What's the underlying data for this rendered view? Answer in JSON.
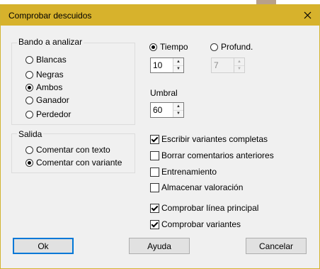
{
  "window": {
    "title": "Comprobar descuidos"
  },
  "side_group": {
    "label": "Bando a analizar",
    "options": [
      "Blancas",
      "Negras",
      "Ambos",
      "Ganador",
      "Perdedor"
    ],
    "selected": "Ambos"
  },
  "output_group": {
    "label": "Salida",
    "options": [
      "Comentar con texto",
      "Comentar con variante"
    ],
    "selected": "Comentar con variante"
  },
  "mode": {
    "time_label": "Tiempo",
    "time_value": "10",
    "depth_label": "Profund.",
    "depth_value": "7",
    "selected": "Tiempo"
  },
  "threshold": {
    "label": "Umbral",
    "value": "60"
  },
  "options": {
    "full_variants": {
      "label": "Escribir variantes completas",
      "checked": true
    },
    "clear_comments": {
      "label": "Borrar comentarios anteriores",
      "checked": false
    },
    "training": {
      "label": "Entrenamiento",
      "checked": false
    },
    "store_eval": {
      "label": "Almacenar valoración",
      "checked": false
    },
    "check_mainline": {
      "label": "Comprobar línea principal",
      "checked": true
    },
    "check_variants": {
      "label": "Comprobar variantes",
      "checked": true
    }
  },
  "buttons": {
    "ok": "Ok",
    "help": "Ayuda",
    "cancel": "Cancelar"
  },
  "colors": {
    "titlebar": "#d7b22c",
    "default_button_border": "#0078d7"
  }
}
